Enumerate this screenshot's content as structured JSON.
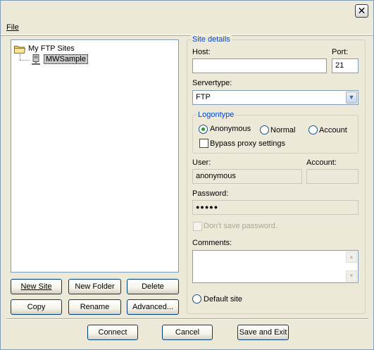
{
  "titlebar": {
    "close_glyph": "✕"
  },
  "menu": {
    "file": "File"
  },
  "tree": {
    "root_label": "My FTP Sites",
    "root_icon": "folder-icon",
    "child_label": "MWSample",
    "child_icon": "server-icon"
  },
  "left_buttons": {
    "new_site": "New Site",
    "new_folder": "New Folder",
    "delete": "Delete",
    "copy": "Copy",
    "rename": "Rename",
    "advanced": "Advanced..."
  },
  "site_details": {
    "title": "Site details",
    "host_label": "Host:",
    "host_value": "",
    "port_label": "Port:",
    "port_value": "21",
    "servertype_label": "Servertype:",
    "servertype_value": "FTP",
    "logontype": {
      "title": "Logontype",
      "options": [
        "Anonymous",
        "Normal",
        "Account"
      ],
      "selected": "Anonymous",
      "bypass_proxy": "Bypass proxy settings"
    },
    "user_label": "User:",
    "user_value": "anonymous",
    "account_label": "Account:",
    "account_value": "",
    "password_label": "Password:",
    "password_value": "●●●●●",
    "dont_save_password": "Don't save password.",
    "comments_label": "Comments:",
    "default_site": "Default site"
  },
  "bottom_buttons": {
    "connect": "Connect",
    "cancel": "Cancel",
    "save_exit": "Save and Exit"
  }
}
